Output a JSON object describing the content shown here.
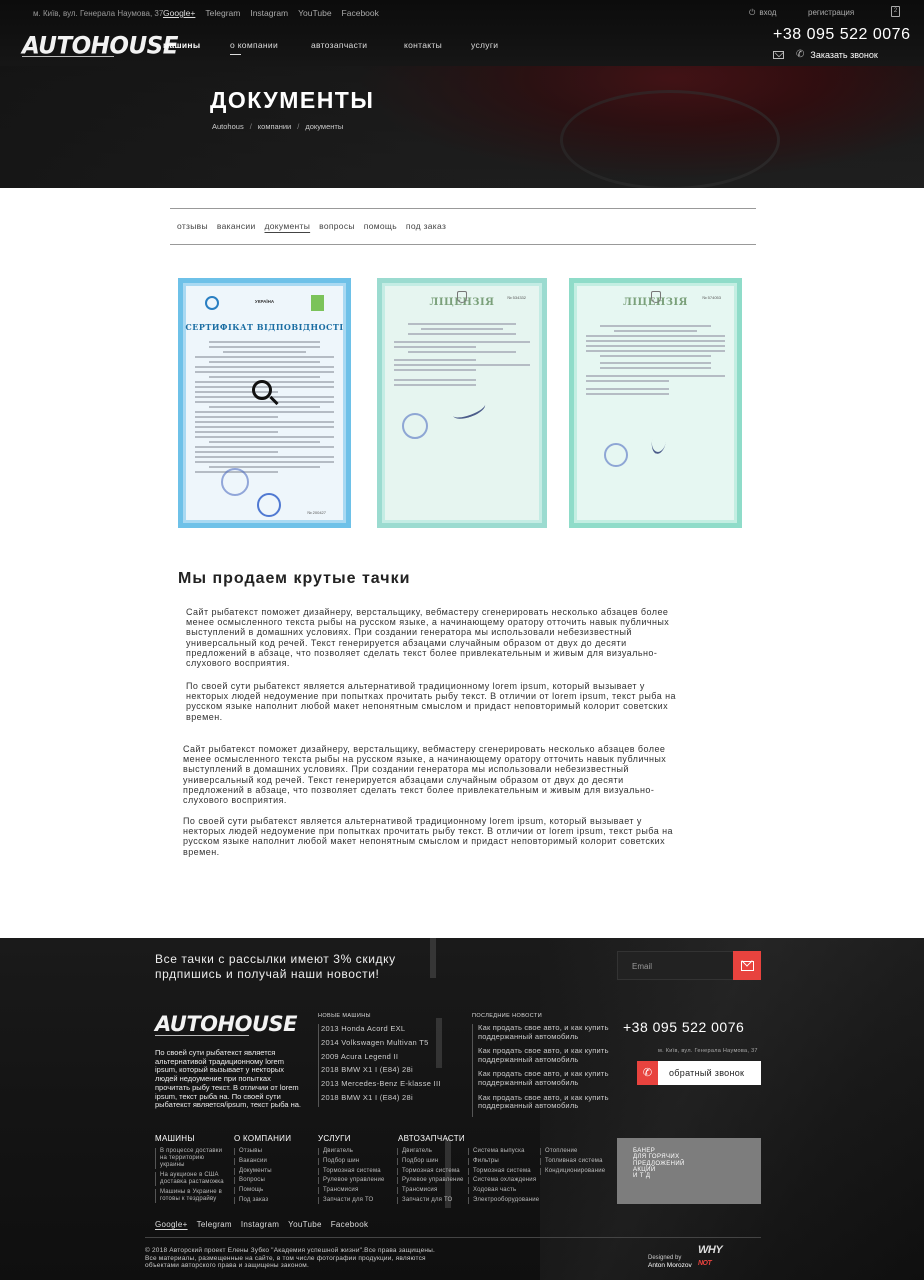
{
  "header": {
    "address": "м. Київ, вул. Генерала Наумова, 37",
    "social": [
      "Google+",
      "Telegram",
      "Instagram",
      "YouTube",
      "Facebook"
    ],
    "login": "вход",
    "register": "регистрация",
    "cart_count": "2",
    "logo": "AUTOHOUSE",
    "nav": [
      "машины",
      "о компании",
      "автозапчасти",
      "контакты",
      "услуги"
    ],
    "phone": "+38 095 522 0076",
    "callback": "Заказать звонок"
  },
  "hero": {
    "title": "ДОКУМЕНТЫ",
    "breadcrumbs": [
      "Autohous",
      "компании",
      "документы"
    ],
    "separator": "/"
  },
  "subnav": [
    "отзывы",
    "вакансии",
    "документы",
    "вопросы",
    "помощь",
    "под заказ"
  ],
  "documents": {
    "doc1": {
      "country": "УКРАЇНА",
      "title": "СЕРТИФІКАТ ВІДПОВІДНОСТІ",
      "serial": "№ 200427"
    },
    "doc2": {
      "title": "ЛІЦЕНЗІЯ",
      "serial": "№ 534332"
    },
    "doc3": {
      "title": "ЛІЦЕНЗІЯ",
      "serial": "№ 574053"
    }
  },
  "content": {
    "title": "Мы продаем крутые тачки",
    "p1": "Сайт рыбатекст поможет дизайнеру, верстальщику, вебмастеру сгенерировать несколько абзацев более менее осмысленного текста рыбы на русском языке, а начинающему оратору отточить навык публичных выступлений в домашних условиях. При создании генератора мы использовали небезизвестный универсальный код речей. Текст генерируется абзацами случайным образом от двух до десяти предложений в абзаце, что позволяет сделать текст более привлекательным и живым для визуально-слухового восприятия.",
    "p2": "По своей сути рыбатекст является альтернативой традиционному lorem ipsum, который вызывает у некторых людей недоумение при попытках прочитать рыбу текст. В отличии от lorem ipsum, текст рыба на русском языке наполнит любой макет непонятным смыслом и придаст неповторимый колорит советских времен.",
    "p3": "Сайт рыбатекст поможет дизайнеру, верстальщику, вебмастеру сгенерировать несколько абзацев более менее осмысленного текста рыбы на русском языке, а начинающему оратору отточить навык публичных выступлений в домашних условиях. При создании генератора мы использовали небезизвестный универсальный код речей. Текст генерируется абзацами случайным образом от двух до десяти предложений в абзаце, что позволяет сделать текст более привлекательным и живым для визуально-слухового восприятия.",
    "p4": "По своей сути рыбатекст является альтернативой традиционному lorem ipsum, который вызывает у некторых людей недоумение при попытках прочитать рыбу текст. В отличии от lorem ipsum, текст рыба на русском языке наполнит любой макет непонятным смыслом и придаст неповторимый колорит советских времен."
  },
  "footer": {
    "subscribe_line1": "Все тачки с рассылки имеют 3% скидку",
    "subscribe_line2": "прдпишись и получай наши новости!",
    "email_placeholder": "Email",
    "logo": "AUTOHOUSE",
    "about": "По своей сути рыбатекст является альтернативой традиционному lorem ipsum, который вызывает у некторых людей недоумение при попытках прочитать рыбу текст. В отличии от lorem ipsum, текст рыба на. По своей сути рыбатекст является/ipsum, текст рыба на.",
    "new_cars_head": "НОВЫЕ МАШИНЫ",
    "new_cars": [
      "2013 Honda Acord EXL",
      "2014 Volkswagen Multivan T5",
      "2009 Acura Legend II",
      "2018 BMW X1 I (E84) 28i",
      "2013 Mercedes-Benz E-klasse III",
      "2018 BMW X1 I (E84) 28i"
    ],
    "news_head": "ПОСЛЕДНИЕ НОВОСТИ",
    "news": [
      "Как продать свое авто, и как купить поддержанный автомобиль",
      "Как продать свое авто, и как купить поддержанный автомобиль",
      "Как продать свое авто, и как купить поддержанный автомобиль",
      "Как продать свое авто, и как купить поддержанный автомобиль"
    ],
    "phone": "+38 095 522 0076",
    "address": "м. Київ, вул. Генерала Наумова, 37",
    "callback": "обратный звонок",
    "menu": {
      "cars_head": "МАШИНЫ",
      "cars": [
        "В процессе доставки на территорию украины",
        "На аукционе в США доставка растаможка",
        "Машины в Украине в готовы к тездрайву"
      ],
      "company_head": "О КОМПАНИИ",
      "company": [
        "Отзывы",
        "Вакансии",
        "Документы",
        "Вопросы",
        "Помощь",
        "Под заказ"
      ],
      "services_head": "УСЛУГИ",
      "services": [
        "Двигатель",
        "Подбор шин",
        "Тормозная система",
        "Рулевое управление",
        "Трансмисия",
        "Запчасти для ТО"
      ],
      "parts_head": "АВТОЗАПЧАСТИ",
      "parts1": [
        "Двигатель",
        "Подбор шин",
        "Тормозная система",
        "Рулевое управление",
        "Трансмисия",
        "Запчасти для ТО"
      ],
      "parts2": [
        "Система выпуска",
        "Фильтры",
        "Тормозная система",
        "Система охлаждения",
        "Ходовая часть",
        "Электрооборудование"
      ],
      "parts3": [
        "Отопление",
        "Топливная система",
        "Кондиционирование"
      ]
    },
    "banner": [
      "БАНЕР",
      "ДЛЯ ГОРЯЧИХ",
      "ПРЕДЛОЖЕНИЙ",
      "АКЦИЙ",
      "И Т Д"
    ],
    "social": [
      "Google+",
      "Telegram",
      "Instagram",
      "YouTube",
      "Facebook"
    ],
    "copyright": "© 2018 Авторский проект Елены Зубко \"Академия успешной жизни\".Все права защищены. Все материалы, размещенные на сайте, в том числе фотографии продукции, являются объектами авторского права и защищены законом.",
    "designed_by": "Designed by",
    "designer": "Anton Morozov",
    "why_not": "WHY",
    "why_not_red": "NOT"
  }
}
